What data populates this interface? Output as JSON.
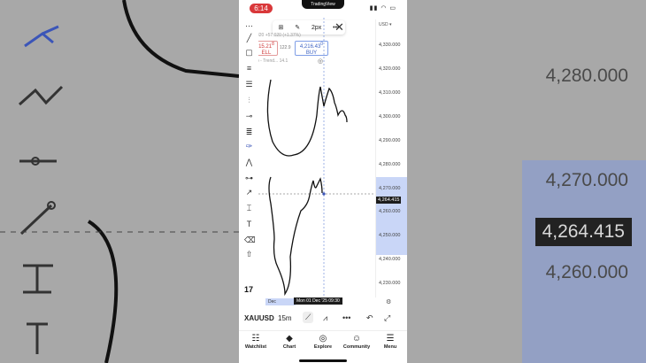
{
  "status_bar": {
    "time": "6:14",
    "island_label": "TradingView"
  },
  "toolbar": {
    "stroke_width": "2px",
    "more": "•••",
    "close": "✕"
  },
  "quote": {
    "sell_price": "15.21",
    "sell_price_sup": "8",
    "sell_label": "ELL",
    "buy_price": "4,216.43",
    "buy_price_sup": "0",
    "buy_label": "BUY",
    "spread": "122.9",
    "change": "820 +57.020 (+1.37%)",
    "indicator": "o - Trend... 14.1"
  },
  "price_axis": {
    "currency": "USD",
    "ticks": [
      "4,330.000",
      "4,320.000",
      "4,310.000",
      "4,300.000",
      "4,290.000",
      "4,280.000",
      "4,270.000",
      "4,260.000",
      "4,250.000",
      "4,240.000",
      "4,230.000"
    ],
    "current": "4,264.415"
  },
  "background_axis": {
    "ticks": [
      "4,280.000",
      "4,270.000",
      "4,264.415",
      "4,260.000"
    ]
  },
  "time_axis": {
    "month": "Dec",
    "cursor": "Mon 01 Dec '25   09:30"
  },
  "controls": {
    "symbol": "XAUUSD",
    "interval": "15m",
    "more": "•••"
  },
  "tabs": [
    {
      "label": "Watchlist",
      "icon": "watchlist-icon"
    },
    {
      "label": "Chart",
      "icon": "chart-icon"
    },
    {
      "label": "Explore",
      "icon": "compass-icon"
    },
    {
      "label": "Community",
      "icon": "people-icon"
    },
    {
      "label": "Menu",
      "icon": "menu-icon"
    }
  ],
  "colors": {
    "sell": "#d03a3a",
    "buy": "#3e63c2",
    "selection_band": "#c9d6f7"
  }
}
